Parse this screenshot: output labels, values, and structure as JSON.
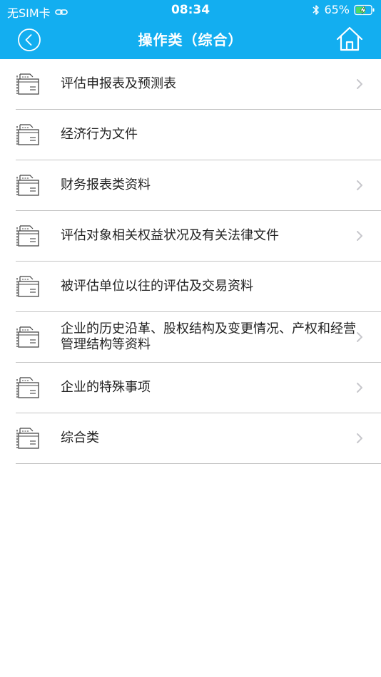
{
  "status_bar": {
    "carrier": "无SIM卡",
    "time": "08:34",
    "battery": "65%"
  },
  "nav": {
    "title": "操作类（综合）",
    "back_icon": "chevron-left-circle-icon",
    "home_icon": "home-icon"
  },
  "items": [
    {
      "label": "评估申报表及预测表",
      "icon": "document-folder-icon",
      "has_chevron": true
    },
    {
      "label": "经济行为文件",
      "icon": "document-folder-icon",
      "has_chevron": false
    },
    {
      "label": "财务报表类资料",
      "icon": "document-folder-icon",
      "has_chevron": true
    },
    {
      "label": "评估对象相关权益状况及有关法律文件",
      "icon": "document-folder-icon",
      "has_chevron": true
    },
    {
      "label": "被评估单位以往的评估及交易资料",
      "icon": "document-folder-icon",
      "has_chevron": false
    },
    {
      "label": "企业的历史沿革、股权结构及变更情况、产权和经营管理结构等资料",
      "icon": "document-folder-icon",
      "has_chevron": true
    },
    {
      "label": "企业的特殊事项",
      "icon": "document-folder-icon",
      "has_chevron": true
    },
    {
      "label": "综合类",
      "icon": "document-folder-icon",
      "has_chevron": true
    }
  ],
  "colors": {
    "header_bg": "#13aef0",
    "divider": "#c4c4c4",
    "chevron": "#c7c7cc"
  }
}
